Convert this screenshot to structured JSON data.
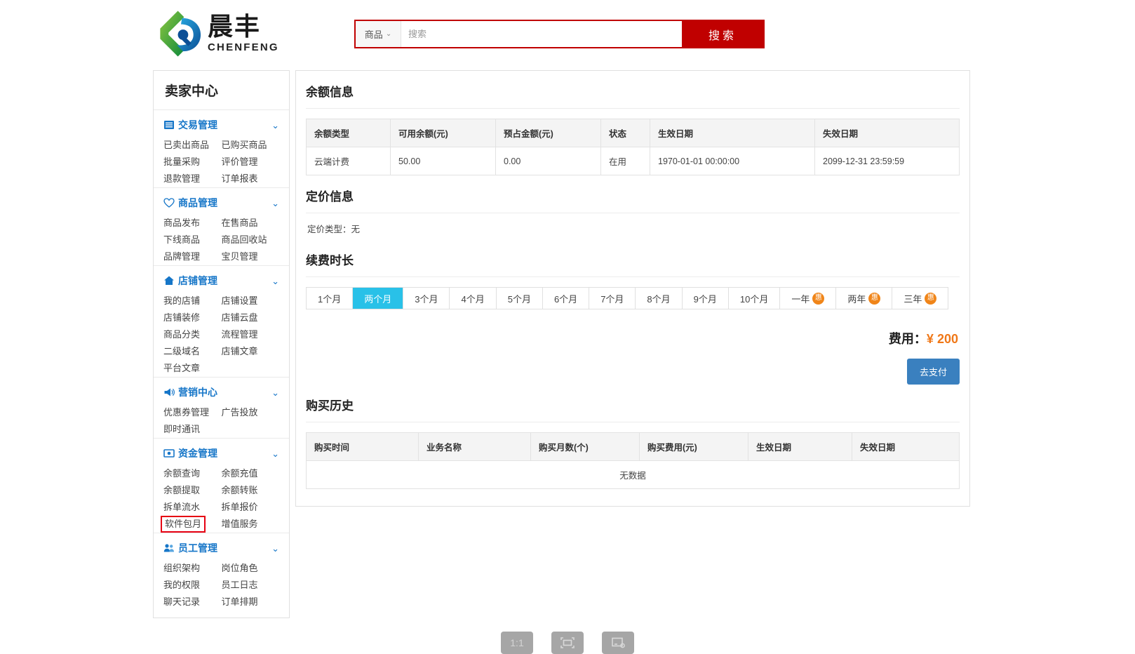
{
  "header": {
    "logo": {
      "cn": "晨丰",
      "en": "CHENFENG",
      "icon": "chenfeng-logo-icon"
    },
    "search": {
      "category": "商品",
      "category_caret": "⌄",
      "placeholder": "搜索",
      "value": "",
      "button": "搜索"
    }
  },
  "sidebar": {
    "title": "卖家中心",
    "chevron": "⌄",
    "groups": [
      {
        "label": "交易管理",
        "icon": "list-icon",
        "links": [
          "已卖出商品",
          "已购买商品",
          "批量采购",
          "评价管理",
          "退款管理",
          "订单报表"
        ]
      },
      {
        "label": "商品管理",
        "icon": "heart-icon",
        "links": [
          "商品发布",
          "在售商品",
          "下线商品",
          "商品回收站",
          "品牌管理",
          "宝贝管理"
        ]
      },
      {
        "label": "店铺管理",
        "icon": "home-icon",
        "links": [
          "我的店铺",
          "店铺设置",
          "店铺装修",
          "店铺云盘",
          "商品分类",
          "流程管理",
          "二级域名",
          "店铺文章",
          "平台文章"
        ]
      },
      {
        "label": "营销中心",
        "icon": "megaphone-icon",
        "links": [
          "优惠券管理",
          "广告投放",
          "即时通讯"
        ]
      },
      {
        "label": "资金管理",
        "icon": "money-icon",
        "links": [
          "余额查询",
          "余额充值",
          "余额提取",
          "余额转账",
          "拆单流水",
          "拆单报价",
          "软件包月",
          "增值服务"
        ],
        "highlighted_link": "软件包月"
      },
      {
        "label": "员工管理",
        "icon": "people-icon",
        "links": [
          "组织架构",
          "岗位角色",
          "我的权限",
          "员工日志",
          "聊天记录",
          "订单排期"
        ]
      }
    ]
  },
  "main": {
    "balance": {
      "title": "余额信息",
      "columns": [
        "余额类型",
        "可用余额(元)",
        "预占金额(元)",
        "状态",
        "生效日期",
        "失效日期"
      ],
      "rows": [
        [
          "云端计费",
          "50.00",
          "0.00",
          "在用",
          "1970-01-01 00:00:00",
          "2099-12-31 23:59:59"
        ]
      ]
    },
    "pricing": {
      "title": "定价信息",
      "type_line": "定价类型：无"
    },
    "renewal": {
      "title": "续费时长",
      "options": [
        {
          "label": "1个月",
          "active": false,
          "promo": false
        },
        {
          "label": "两个月",
          "active": true,
          "promo": false
        },
        {
          "label": "3个月",
          "active": false,
          "promo": false
        },
        {
          "label": "4个月",
          "active": false,
          "promo": false
        },
        {
          "label": "5个月",
          "active": false,
          "promo": false
        },
        {
          "label": "6个月",
          "active": false,
          "promo": false
        },
        {
          "label": "7个月",
          "active": false,
          "promo": false
        },
        {
          "label": "8个月",
          "active": false,
          "promo": false
        },
        {
          "label": "9个月",
          "active": false,
          "promo": false
        },
        {
          "label": "10个月",
          "active": false,
          "promo": false
        },
        {
          "label": "一年",
          "active": false,
          "promo": true
        },
        {
          "label": "两年",
          "active": false,
          "promo": true
        },
        {
          "label": "三年",
          "active": false,
          "promo": true
        }
      ],
      "promo_badge": "惠",
      "fee_label": "费用：",
      "fee_currency": "¥",
      "fee_amount": "200",
      "pay_button": "去支付"
    },
    "history": {
      "title": "购买历史",
      "columns": [
        "购买时间",
        "业务名称",
        "购买月数(个)",
        "购买费用(元)",
        "生效日期",
        "失效日期"
      ],
      "empty_text": "无数据",
      "rows": []
    }
  },
  "bottom_toolbar": {
    "buttons": [
      {
        "label": "1:1",
        "icon": "actual-size-icon"
      },
      {
        "label": "",
        "icon": "fit-screen-icon"
      },
      {
        "label": "",
        "icon": "screenshot-icon"
      }
    ]
  },
  "colors": {
    "brand_red": "#c00000",
    "accent_blue": "#1676c8",
    "active_cyan": "#29c1e8",
    "promo_orange": "#f08519",
    "fee_orange": "#f07818",
    "pay_blue": "#3a80bf",
    "highlight_red": "#e60012"
  }
}
